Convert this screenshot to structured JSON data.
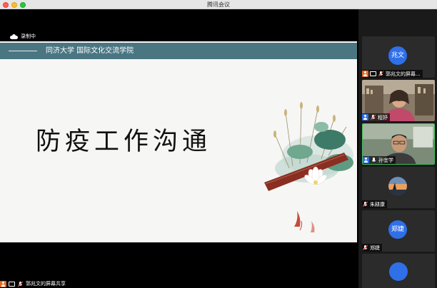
{
  "window": {
    "title": "腾讯会议"
  },
  "recording": {
    "label": "录制中"
  },
  "slide": {
    "header_text": "同济大学  国际文化交流学院",
    "title": "防疫工作沟通"
  },
  "share_bar": {
    "label": "郭兆文的屏幕共享"
  },
  "participants": [
    {
      "name": "郭兆文的屏幕...",
      "avatar_text": "兆文",
      "type": "avatar"
    },
    {
      "name": "程妤",
      "type": "video"
    },
    {
      "name": "孙宜学",
      "type": "video",
      "active": true
    },
    {
      "name": "朱耕康",
      "type": "image"
    },
    {
      "name": "郑婕",
      "avatar_text": "郑婕",
      "type": "avatar"
    }
  ],
  "colors": {
    "slide_header": "#4a7682",
    "avatar": "#2f6fe8",
    "active_border": "#3fc05a",
    "host_badge": "#e46a2a"
  }
}
